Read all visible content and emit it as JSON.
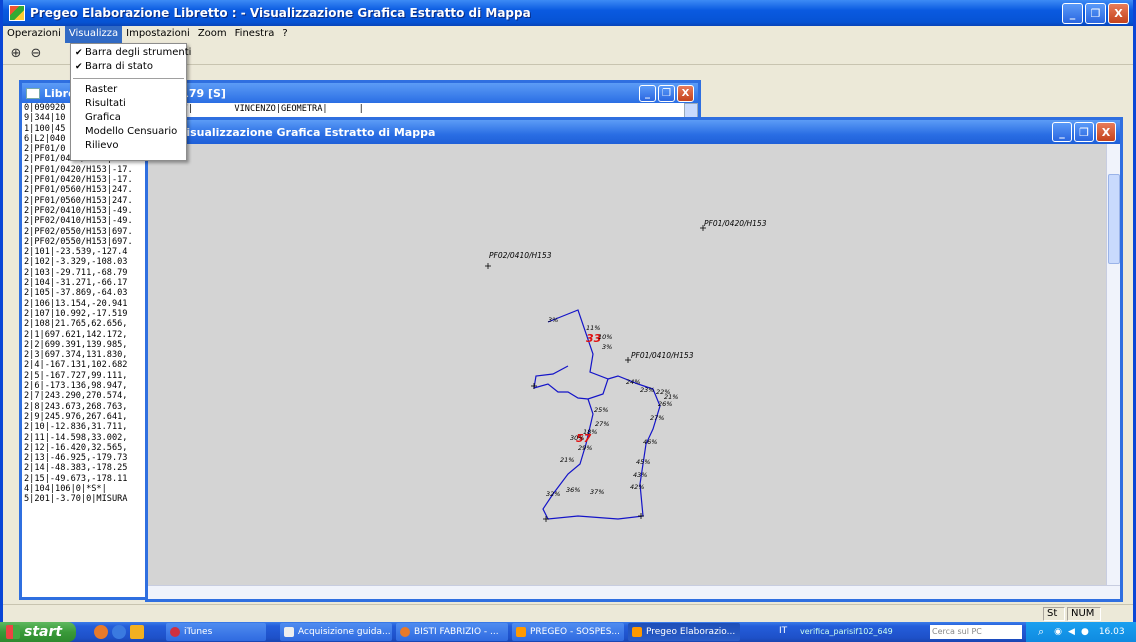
{
  "app": {
    "title": "Pregeo Elaborazione Libretto : -  Visualizzazione Grafica Estratto di Mappa",
    "window_buttons": [
      "_",
      "❐",
      "X"
    ]
  },
  "menu": {
    "items": [
      "Operazioni",
      "Visualizza",
      "Impostazioni",
      "Zoom",
      "Finestra",
      "?"
    ]
  },
  "toolbar": {
    "zoom_in_glyph": "⊕",
    "zoom_out_glyph": "⊖"
  },
  "dropdown": {
    "checked_items": [
      "Barra degli strumenti",
      "Barra di stato"
    ],
    "items": [
      "Raster",
      "Risultati",
      "Grafica",
      "Modello Censuario",
      "Rilievo"
    ]
  },
  "libretto": {
    "title": "Libretto  6 Protocollo=179 [S]",
    "row1_tail": "36,57|        VINCENZO|GEOMETRA|      |",
    "lines": [
      "0|090920",
      "9|344|10",
      "1|100|45",
      "6|L2|040",
      "2|PF01/0",
      "2|PF01/0410/H153|-14.",
      "2|PF01/0420/H153|-17.",
      "2|PF01/0420/H153|-17.",
      "2|PF01/0560/H153|247.",
      "2|PF01/0560/H153|247.",
      "2|PF02/0410/H153|-49.",
      "2|PF02/0410/H153|-49.",
      "2|PF02/0550/H153|697.",
      "2|PF02/0550/H153|697.",
      "2|101|-23.539,-127.4",
      "2|102|-3.329,-108.03",
      "2|103|-29.711,-68.79",
      "2|104|-31.271,-66.17",
      "2|105|-37.869,-64.03",
      "2|106|13.154,-20.941",
      "2|107|10.992,-17.519",
      "2|108|21.765,62.656,",
      "2|1|697.621,142.172,",
      "2|2|699.391,139.985,",
      "2|3|697.374,131.830,",
      "2|4|-167.131,102.682",
      "2|5|-167.727,99.111,",
      "2|6|-173.136,98.947,",
      "2|7|243.290,270.574,",
      "2|8|243.673,268.763,",
      "2|9|245.976,267.641,",
      "2|10|-12.836,31.711,",
      "2|11|-14.598,33.002,",
      "2|12|-16.420,32.565,",
      "2|13|-46.925,-179.73",
      "2|14|-48.383,-178.25",
      "2|15|-49.673,-178.11",
      "4|104|106|0|*S*|",
      "5|201|-3.70|0|MISURA"
    ]
  },
  "mappa": {
    "title": "Visualizzazione Grafica Estratto di Mappa",
    "labels": {
      "pf01_0420": "PF01/0420/H153",
      "pf02_0410": "PF02/0410/H153",
      "pf01_0410": "PF01/0410/H153",
      "parcel_a": "33",
      "parcel_b": "57",
      "pct": [
        "3%",
        "11%",
        "10%",
        "3%",
        "24%",
        "23%",
        "22%",
        "21%",
        "26%",
        "27%",
        "25%",
        "27%",
        "18%",
        "30%",
        "29%",
        "21%",
        "46%",
        "45%",
        "43%",
        "42%",
        "36%",
        "37%",
        "32%"
      ]
    }
  },
  "statusbar": {
    "st": "St",
    "num": "NUM"
  },
  "taskbar": {
    "start": "start",
    "tasks": [
      "iTunes",
      "Acquisizione guida...",
      "BISTI FABRIZIO - ...",
      "PREGEO - SOSPES...",
      "Pregeo Elaborazio..."
    ],
    "language": "IT",
    "version_label": "verifica_parisif102_649",
    "search_placeholder": "Cerca sul PC",
    "clock": "16.03",
    "colors": {
      "taskbar": "#245edb",
      "start": "#3a9a3a",
      "active_menu": "#316ac5"
    }
  }
}
